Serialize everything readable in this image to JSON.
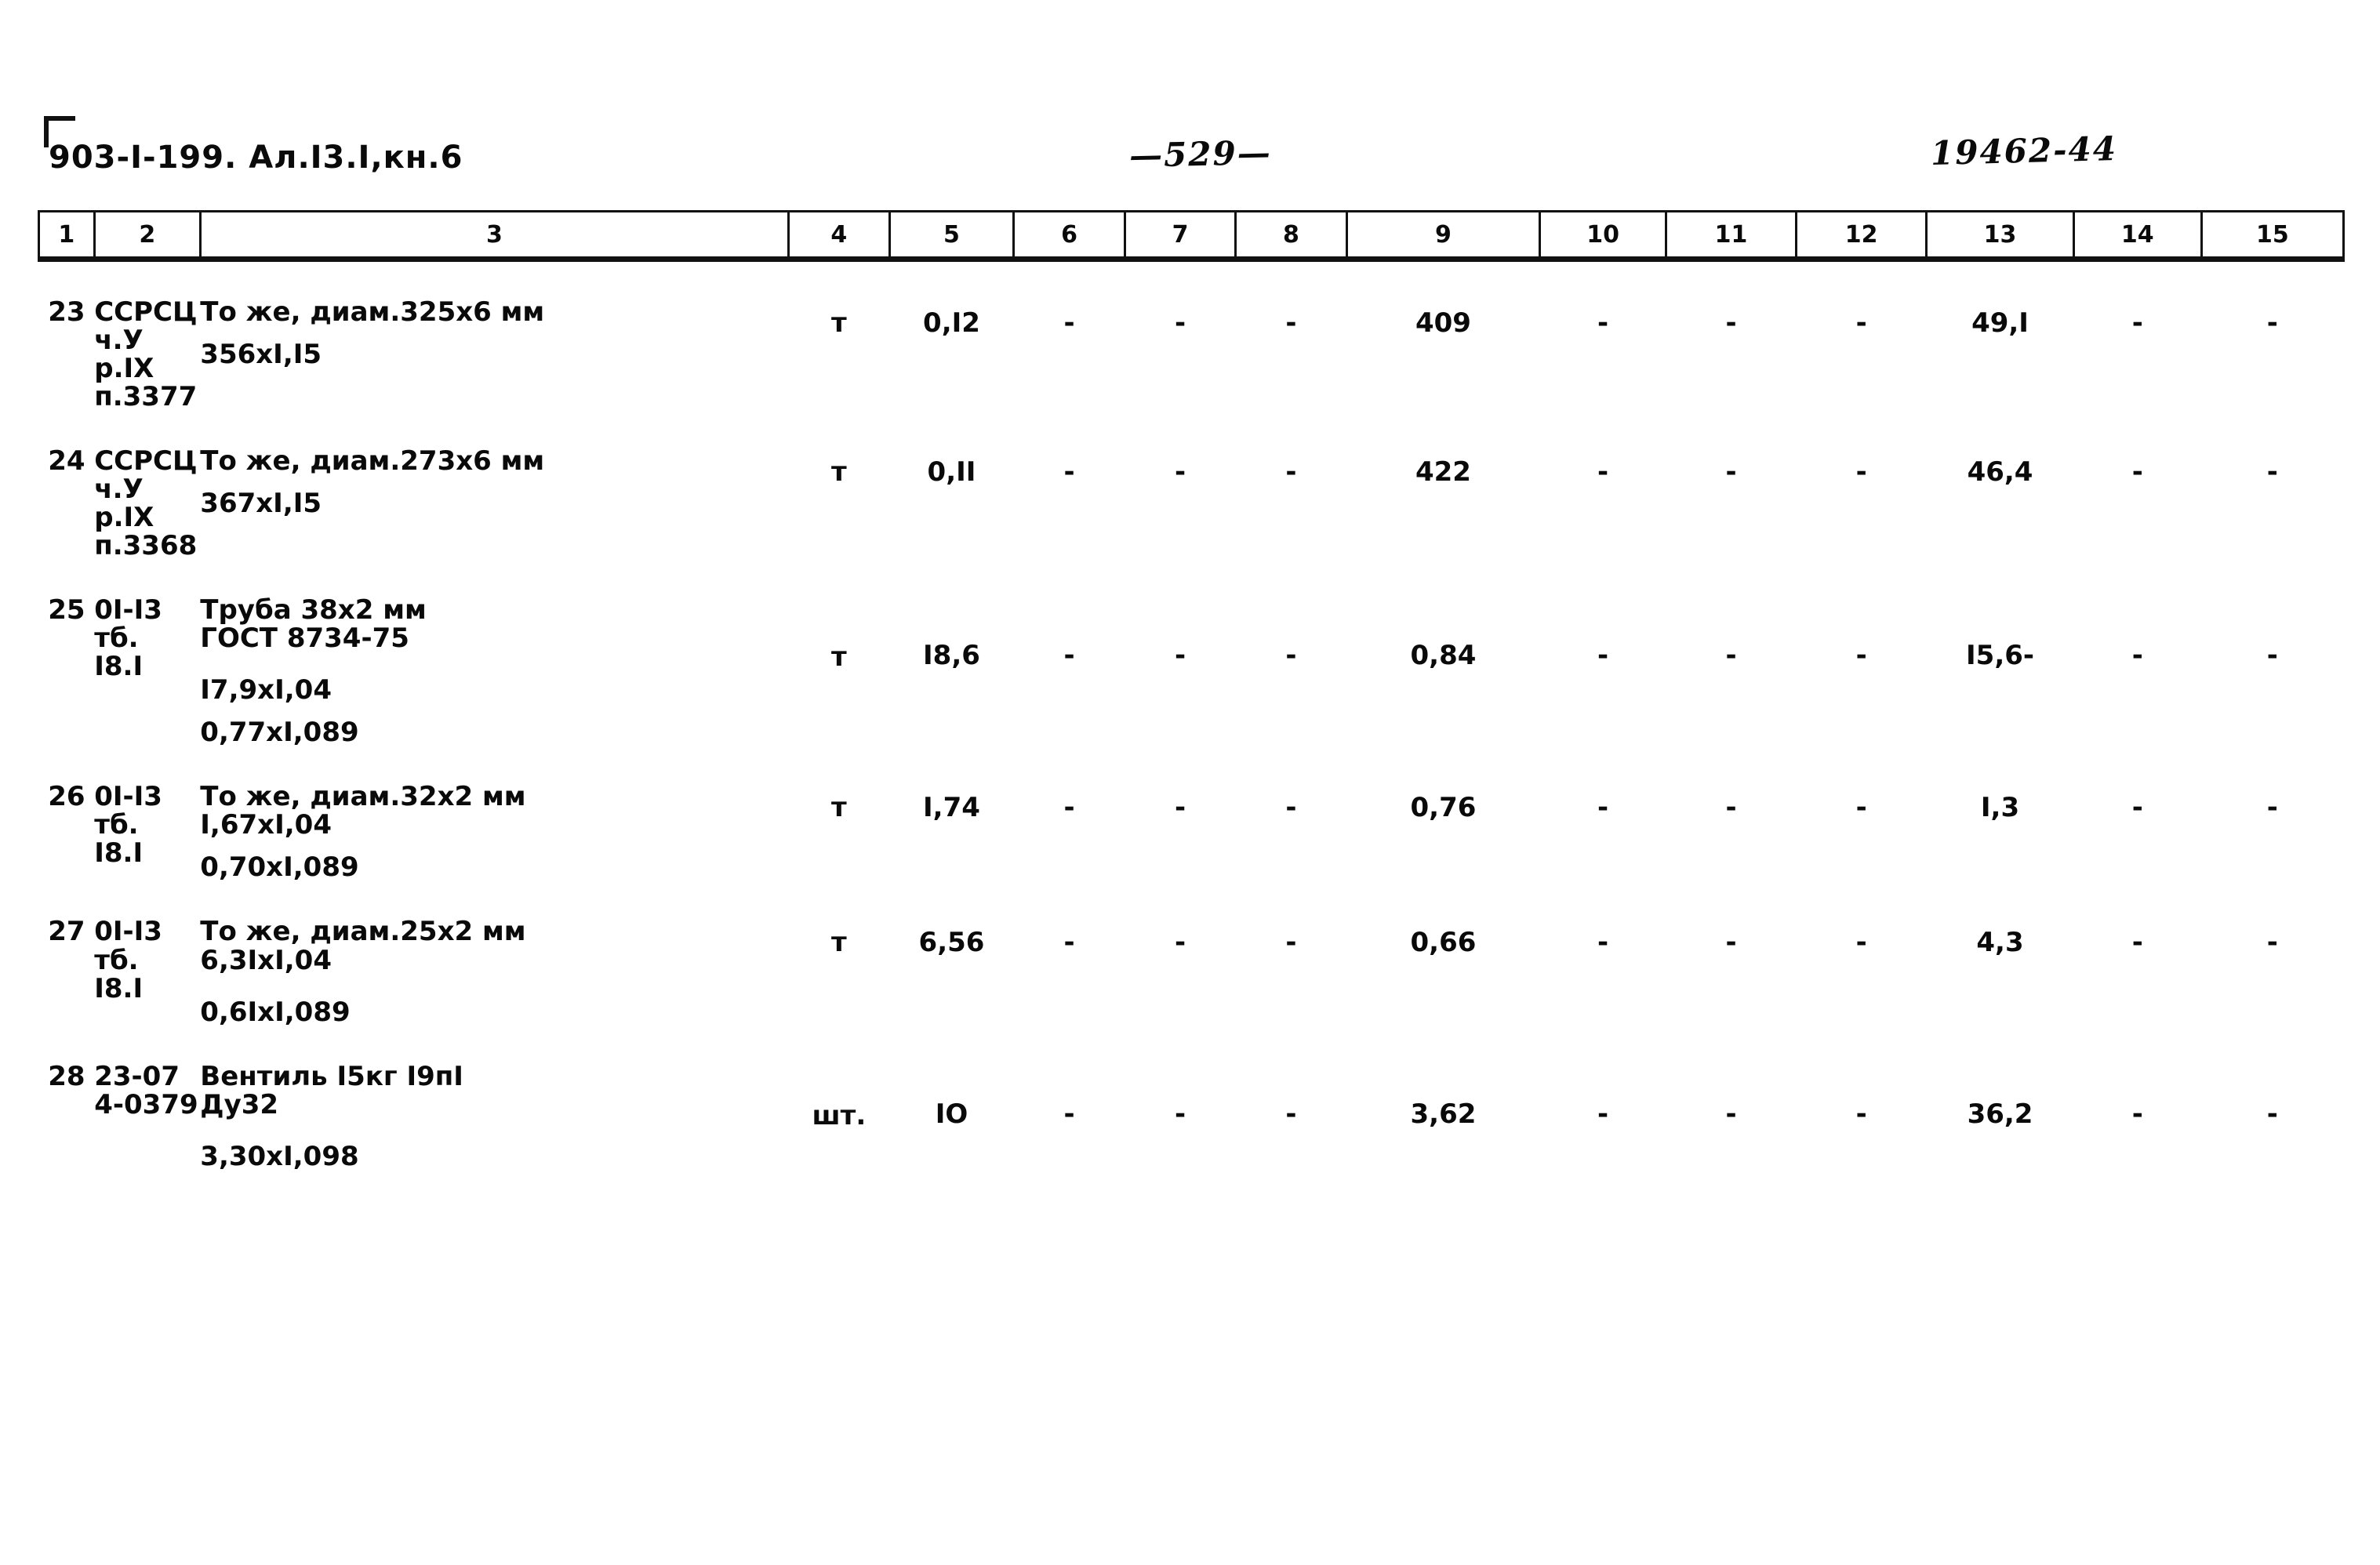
{
  "header": {
    "doc_code": "903-I-199. Ал.I3.I,кн.6",
    "page_number": "—529—",
    "archive_code": "19462-44",
    "corner_mark": "corner-bracket"
  },
  "table": {
    "column_numbers": [
      "1",
      "2",
      "3",
      "4",
      "5",
      "6",
      "7",
      "8",
      "9",
      "10",
      "11",
      "12",
      "13",
      "14",
      "15"
    ],
    "rows": [
      {
        "num": "23",
        "code_lines": [
          "ССРСЦ",
          "ч.У",
          "р.IX",
          "п.3377"
        ],
        "desc_lines": [
          "То же, диам.325х6 мм",
          "",
          "356хI,I5"
        ],
        "unit": "т",
        "c5": "0,I2",
        "c6": "-",
        "c7": "-",
        "c8": "-",
        "c9": "409",
        "c10": "-",
        "c11": "-",
        "c12": "-",
        "c13": "49,I",
        "c14": "-",
        "c15": "-"
      },
      {
        "num": "24",
        "code_lines": [
          "ССРСЦ",
          "ч.У",
          "р.IX",
          "п.3368"
        ],
        "desc_lines": [
          "То же, диам.273х6 мм",
          "",
          "367хI,I5"
        ],
        "unit": "т",
        "c5": "0,II",
        "c6": "-",
        "c7": "-",
        "c8": "-",
        "c9": "422",
        "c10": "-",
        "c11": "-",
        "c12": "-",
        "c13": "46,4",
        "c14": "-",
        "c15": "-"
      },
      {
        "num": "25",
        "code_lines": [
          "0I-I3",
          "тб.",
          "I8.I"
        ],
        "desc_lines": [
          "Труба 38х2 мм",
          "ГОСТ 8734-75",
          "",
          "I7,9хI,04",
          "",
          "0,77хI,089"
        ],
        "unit": "т",
        "c5": "I8,6",
        "c6": "-",
        "c7": "-",
        "c8": "-",
        "c9": "0,84",
        "c10": "-",
        "c11": "-",
        "c12": "-",
        "c13": "I5,6-",
        "c14": "-",
        "c15": "-"
      },
      {
        "num": "26",
        "code_lines": [
          "0I-I3",
          "тб.",
          "I8.I"
        ],
        "desc_lines": [
          "То же, диам.32х2 мм",
          "I,67хI,04",
          "",
          "0,70хI,089"
        ],
        "unit": "т",
        "c5": "I,74",
        "c6": "-",
        "c7": "-",
        "c8": "-",
        "c9": "0,76",
        "c10": "-",
        "c11": "-",
        "c12": "-",
        "c13": "I,3",
        "c14": "-",
        "c15": "-"
      },
      {
        "num": "27",
        "code_lines": [
          "0I-I3",
          "тб.",
          "I8.I"
        ],
        "desc_lines": [
          "То же, диам.25х2 мм",
          "6,3IхI,04",
          "",
          "0,6IхI,089"
        ],
        "unit": "т",
        "c5": "6,56",
        "c6": "-",
        "c7": "-",
        "c8": "-",
        "c9": "0,66",
        "c10": "-",
        "c11": "-",
        "c12": "-",
        "c13": "4,3",
        "c14": "-",
        "c15": "-"
      },
      {
        "num": "28",
        "code_lines": [
          "23-07",
          "4-0379"
        ],
        "desc_lines": [
          "Вентиль I5кг I9пI",
          "Ду32",
          "",
          "3,30хI,098"
        ],
        "unit": "шт.",
        "c5": "IO",
        "c6": "-",
        "c7": "-",
        "c8": "-",
        "c9": "3,62",
        "c10": "-",
        "c11": "-",
        "c12": "-",
        "c13": "36,2",
        "c14": "-",
        "c15": "-"
      }
    ]
  },
  "colors": {
    "ink": "#0a0a0a",
    "paper": "#ffffff"
  }
}
